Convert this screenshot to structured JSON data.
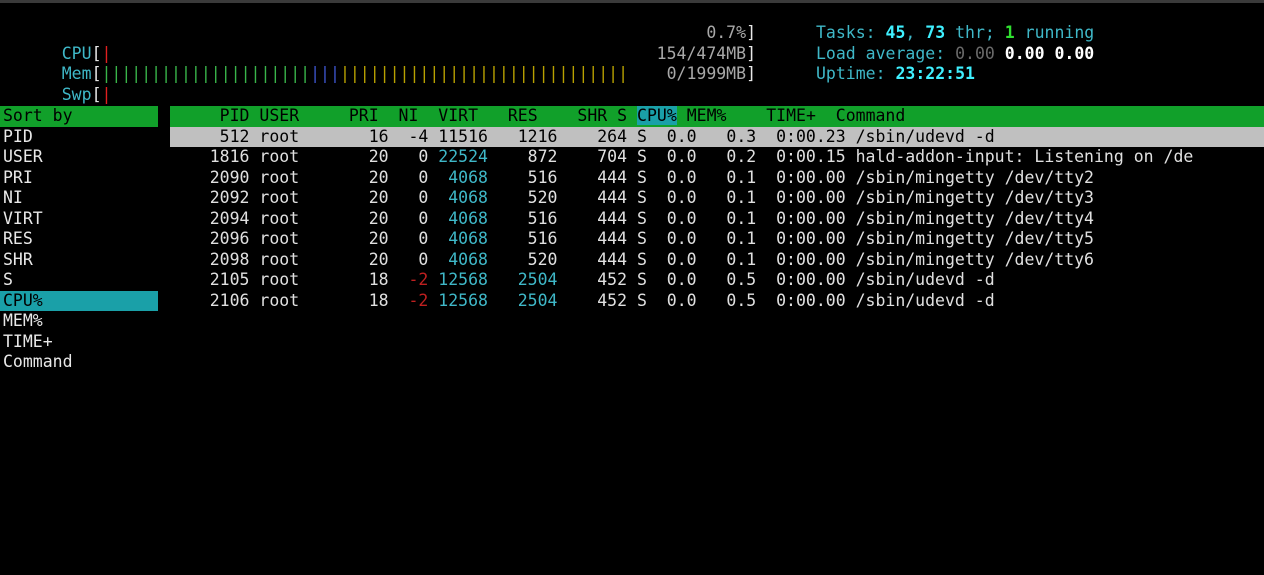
{
  "meters": {
    "cpu": {
      "label": "CPU",
      "value": "0.7%"
    },
    "mem": {
      "label": "Mem",
      "value": "154/474MB"
    },
    "swp": {
      "label": "Swp",
      "value": "0/1999MB"
    }
  },
  "info": {
    "tasks_label": "Tasks: ",
    "tasks": "45",
    "threads": "73",
    "thr_label": " thr; ",
    "running": "1",
    "running_label": " running",
    "load_label": "Load average: ",
    "load1": "0.00",
    "load5": "0.00",
    "load15": "0.00",
    "uptime_label": "Uptime: ",
    "uptime": "23:22:51"
  },
  "sort_panel": {
    "title": "Sort by",
    "items": [
      "PID",
      "USER",
      "PRI",
      "NI",
      "VIRT",
      "RES",
      "SHR",
      "S",
      "CPU%",
      "MEM%",
      "TIME+",
      "Command"
    ],
    "selected": "CPU%"
  },
  "columns": {
    "pid": "PID",
    "user": "USER",
    "pri": "PRI",
    "ni": "NI",
    "virt": "VIRT",
    "res": "RES",
    "shr": "SHR",
    "s": "S",
    "cpu": "CPU%",
    "mem": "MEM%",
    "time": "TIME+",
    "command": "Command"
  },
  "processes": [
    {
      "pid": "512",
      "user": "root",
      "pri": "16",
      "ni": "-4",
      "virt": "11516",
      "res": "1216",
      "shr": "264",
      "s": "S",
      "cpu": "0.0",
      "mem": "0.3",
      "time": "0:00.23",
      "command": "/sbin/udevd -d"
    },
    {
      "pid": "1816",
      "user": "root",
      "pri": "20",
      "ni": "0",
      "virt": "22524",
      "res": "872",
      "shr": "704",
      "s": "S",
      "cpu": "0.0",
      "mem": "0.2",
      "time": "0:00.15",
      "command": "hald-addon-input: Listening on /de"
    },
    {
      "pid": "2090",
      "user": "root",
      "pri": "20",
      "ni": "0",
      "virt": "4068",
      "res": "516",
      "shr": "444",
      "s": "S",
      "cpu": "0.0",
      "mem": "0.1",
      "time": "0:00.00",
      "command": "/sbin/mingetty /dev/tty2"
    },
    {
      "pid": "2092",
      "user": "root",
      "pri": "20",
      "ni": "0",
      "virt": "4068",
      "res": "520",
      "shr": "444",
      "s": "S",
      "cpu": "0.0",
      "mem": "0.1",
      "time": "0:00.00",
      "command": "/sbin/mingetty /dev/tty3"
    },
    {
      "pid": "2094",
      "user": "root",
      "pri": "20",
      "ni": "0",
      "virt": "4068",
      "res": "516",
      "shr": "444",
      "s": "S",
      "cpu": "0.0",
      "mem": "0.1",
      "time": "0:00.00",
      "command": "/sbin/mingetty /dev/tty4"
    },
    {
      "pid": "2096",
      "user": "root",
      "pri": "20",
      "ni": "0",
      "virt": "4068",
      "res": "516",
      "shr": "444",
      "s": "S",
      "cpu": "0.0",
      "mem": "0.1",
      "time": "0:00.00",
      "command": "/sbin/mingetty /dev/tty5"
    },
    {
      "pid": "2098",
      "user": "root",
      "pri": "20",
      "ni": "0",
      "virt": "4068",
      "res": "520",
      "shr": "444",
      "s": "S",
      "cpu": "0.0",
      "mem": "0.1",
      "time": "0:00.00",
      "command": "/sbin/mingetty /dev/tty6"
    },
    {
      "pid": "2105",
      "user": "root",
      "pri": "18",
      "ni": "-2",
      "virt": "12568",
      "res": "2504",
      "shr": "452",
      "s": "S",
      "cpu": "0.0",
      "mem": "0.5",
      "time": "0:00.00",
      "command": "/sbin/udevd -d"
    },
    {
      "pid": "2106",
      "user": "root",
      "pri": "18",
      "ni": "-2",
      "virt": "12568",
      "res": "2504",
      "shr": "452",
      "s": "S",
      "cpu": "0.0",
      "mem": "0.5",
      "time": "0:00.00",
      "command": "/sbin/udevd -d"
    }
  ],
  "selected_row": 0,
  "colors": {
    "background": "#000000",
    "header_bar": "#11a02a",
    "sort_highlight": "#1aa0a8",
    "selected_row": "#c0c0c0",
    "meter_green": "#39b54a",
    "meter_blue": "#3b52c8",
    "meter_yellow": "#b8a000",
    "meter_red": "#e02020"
  },
  "mem_meter": {
    "used_fraction": 0.325,
    "buffers_fraction": 0.05,
    "cache_fraction": 0.5
  }
}
